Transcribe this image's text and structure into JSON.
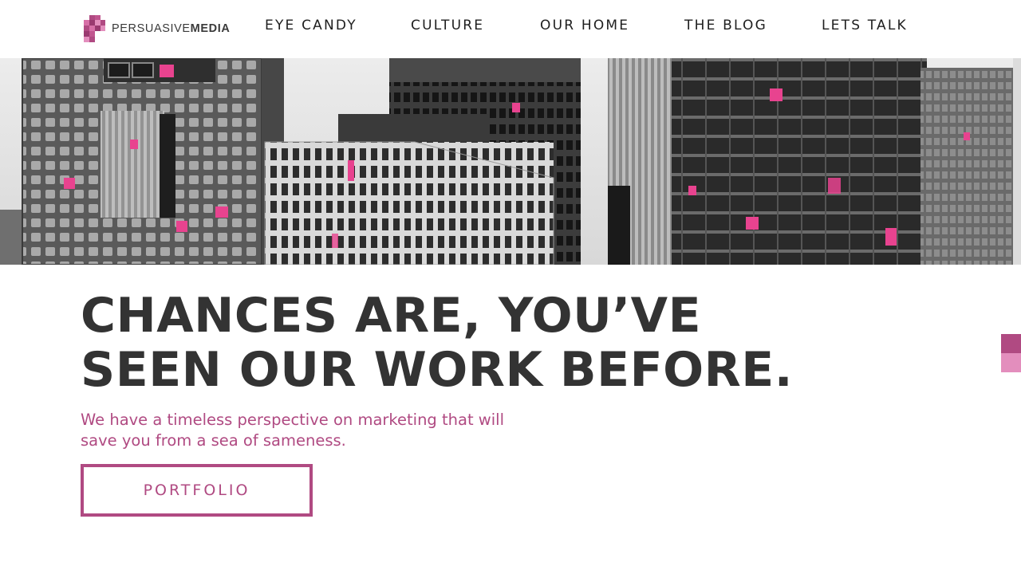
{
  "brand": {
    "logo_prefix": "PERSUASIVE",
    "logo_suffix": "MEDIA",
    "colors": {
      "accent": "#b04a82",
      "pink_highlight": "#e8438f",
      "text_dark": "#333333"
    }
  },
  "nav": {
    "items": [
      {
        "label": "EYE CANDY"
      },
      {
        "label": "CULTURE"
      },
      {
        "label": "OUR HOME"
      },
      {
        "label": "THE BLOG"
      },
      {
        "label": "LETS TALK"
      }
    ]
  },
  "hero": {
    "image": "grayscale-skyscrapers-with-pink-windows"
  },
  "main": {
    "headline_line1": "CHANCES ARE, YOU’VE",
    "headline_line2": "SEEN OUR WORK BEFORE.",
    "subhead": "We have a timeless perspective on marketing that will save you from a sea of sameness.",
    "cta_label": "PORTFOLIO"
  },
  "side_tab": {
    "icon": "pixel-tab-icon"
  }
}
